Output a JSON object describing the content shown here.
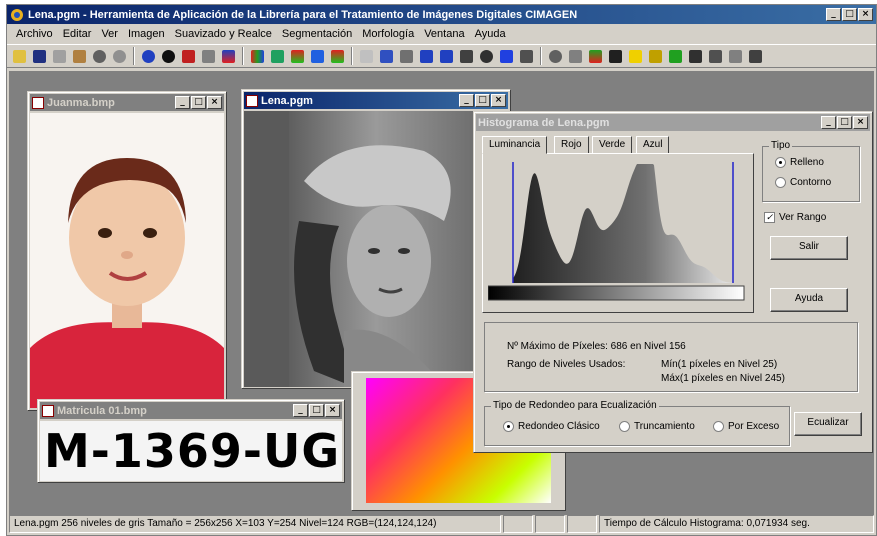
{
  "app": {
    "title": "Lena.pgm - Herramienta de Aplicación de la Librería para el Tratamiento de Imágenes Digitales CIMAGEN",
    "menu": [
      "Archivo",
      "Editar",
      "Ver",
      "Imagen",
      "Suavizado y Realce",
      "Segmentación",
      "Morfología",
      "Ventana",
      "Ayuda"
    ]
  },
  "windows": {
    "child": {
      "title": "Juanma.bmp"
    },
    "lena": {
      "title": "Lena.pgm"
    },
    "matricula": {
      "title": "Matricula 01.bmp",
      "plate_text": "M-1369-UG"
    },
    "histogram": {
      "title": "Histograma de Lena.pgm",
      "tabs": [
        "Luminancia",
        "Rojo",
        "Verde",
        "Azul"
      ],
      "tipo": {
        "label": "Tipo",
        "options": [
          "Relleno",
          "Contorno"
        ],
        "selected": "Relleno"
      },
      "ver_rango": {
        "label": "Ver Rango",
        "checked": true
      },
      "buttons": {
        "salir": "Salir",
        "ayuda": "Ayuda",
        "ecualizar": "Ecualizar"
      },
      "info": {
        "max_pixels": "Nº Máximo de Píxeles: 686 en Nivel 156",
        "rango_label": "Rango de Niveles Usados:",
        "min": "Mín(1 píxeles en Nivel 25)",
        "max": "Máx(1 píxeles en Nivel 245)"
      },
      "redondeo": {
        "label": "Tipo de Redondeo para Ecualización",
        "options": [
          "Redondeo Clásico",
          "Truncamiento",
          "Por Exceso"
        ],
        "selected": "Redondeo Clásico"
      }
    }
  },
  "statusbar": {
    "info": "Lena.pgm 256 niveles de gris Tamaño = 256x256 X=103 Y=254 Nivel=124 RGB=(124,124,124)",
    "timing": "Tiempo de Cálculo Histograma: 0,071934 seg."
  },
  "colors": {
    "title_active": "#0a246a",
    "mdi_bg": "#808080",
    "face": "#d4d0c8",
    "range_line": "#2222cc"
  }
}
